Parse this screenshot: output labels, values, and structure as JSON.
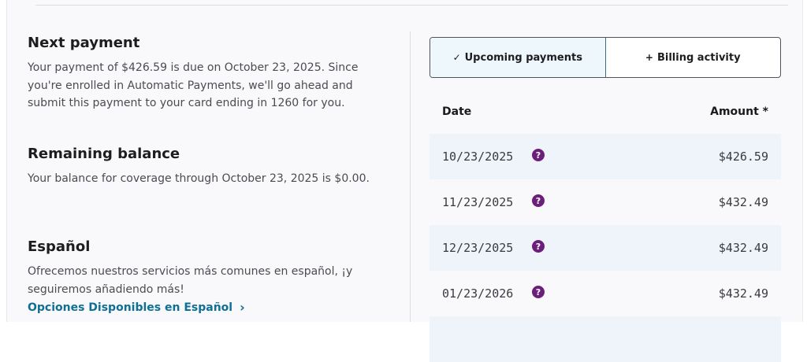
{
  "next_payment": {
    "title": "Next payment",
    "body": "Your payment of $426.59 is due on October 23, 2025. Since you're enrolled in Automatic Payments, we'll go ahead and submit this payment to your card ending in 1260 for you."
  },
  "remaining_balance": {
    "title": "Remaining balance",
    "body": "Your balance for coverage through October 23, 2025 is $0.00."
  },
  "espanol": {
    "title": "Español",
    "body": "Ofrecemos nuestros servicios más comunes en español, ¡y seguiremos añadiendo más!",
    "link_label": "Opciones Disponibles en Español",
    "link_icon": "chevron-right-icon"
  },
  "tabs": [
    {
      "label": "Upcoming payments",
      "icon_char": "✓",
      "icon": "check-icon",
      "active": true
    },
    {
      "label": "Billing activity",
      "icon_char": "+",
      "icon": "plus-icon",
      "active": false
    }
  ],
  "table": {
    "col_date": "Date",
    "col_amount": "Amount *",
    "rows": [
      {
        "date": "10/23/2025",
        "amount": "$426.59",
        "help": "?"
      },
      {
        "date": "11/23/2025",
        "amount": "$432.49",
        "help": "?"
      },
      {
        "date": "12/23/2025",
        "amount": "$432.49",
        "help": "?"
      },
      {
        "date": "01/23/2026",
        "amount": "$432.49",
        "help": "?"
      }
    ]
  },
  "colors": {
    "link": "#0f6f95",
    "help_badge": "#6b1f7a",
    "row_shade": "#eef4fa",
    "active_tab": "#eef7fb"
  }
}
